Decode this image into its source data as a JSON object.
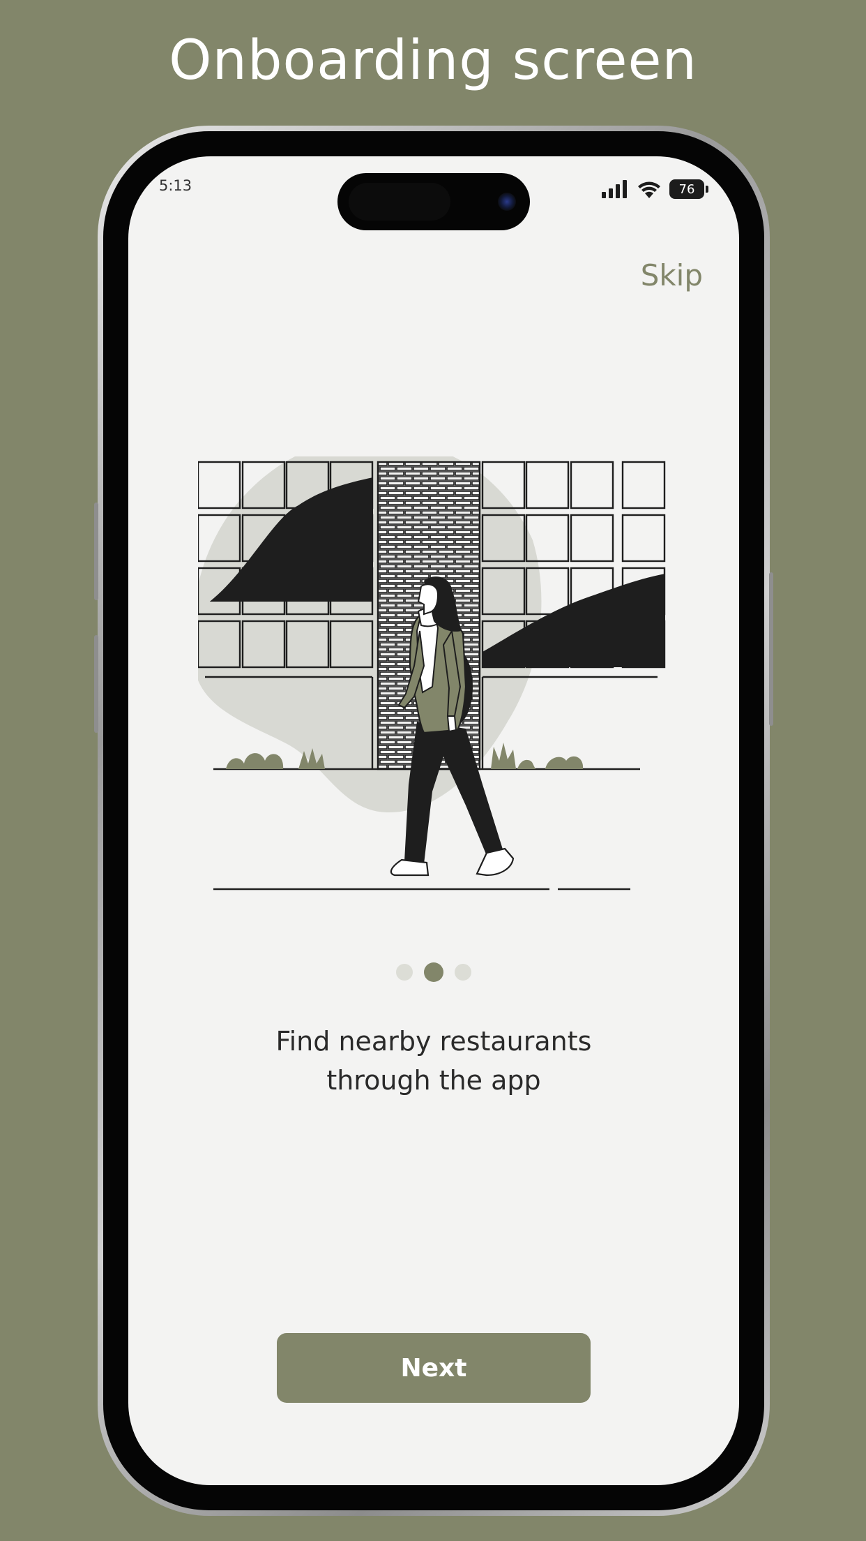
{
  "page": {
    "title": "Onboarding screen"
  },
  "status_bar": {
    "time": "5:13",
    "battery": "76"
  },
  "onboarding": {
    "skip_label": "Skip",
    "caption_line1": "Find nearby restaurants",
    "caption_line2": "through the app",
    "next_label": "Next",
    "step_current": 2,
    "step_total": 3
  },
  "colors": {
    "accent": "#82866a",
    "screen_bg": "#f3f3f2",
    "blob": "#d8d9d3",
    "ink": "#1e1e1e"
  }
}
